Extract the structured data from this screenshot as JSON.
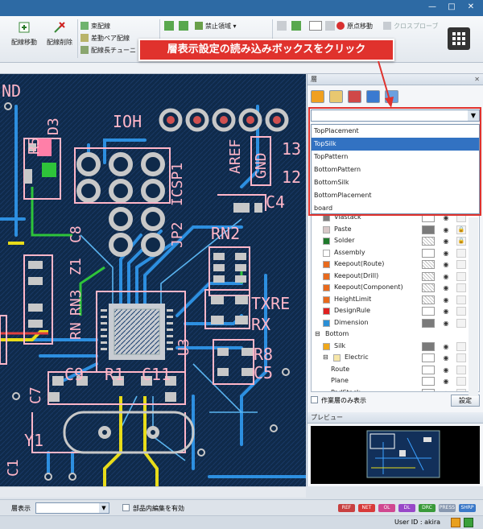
{
  "callout": "層表示設定の読み込みボックスをクリック",
  "ribbon": {
    "route_move": "配線移動",
    "route_delete": "配線削除",
    "bundle_route": "束配線",
    "diff_pair": "差動ペア配線",
    "length_tune": "配線長チューニ",
    "keepout": "禁止領域",
    "origin_move": "原点移動",
    "cross_probe": "クロスプローブ"
  },
  "panel": {
    "title": "層",
    "close": "✕",
    "layer_select_value": "",
    "dropdown_options": [
      "TopPlacement",
      "TopSilk",
      "TopPattern",
      "BottomPattern",
      "BottomSilk",
      "BottomPlacement",
      "board"
    ],
    "selected_option": "TopSilk",
    "layers": [
      {
        "name": "Viastack",
        "color": "#7d7d7d",
        "indent": 1,
        "eye": true
      },
      {
        "name": "Paste",
        "color": "#d8c8c8",
        "indent": 1,
        "eye": true,
        "lock": true,
        "swatch": "#7a7a7a"
      },
      {
        "name": "Solder",
        "color": "#1f7a2b",
        "indent": 1,
        "eye": true,
        "lock": true,
        "hatch": true
      },
      {
        "name": "Assembly",
        "color": "#ffffff",
        "indent": 1,
        "eye": true,
        "swatch": "#ffffff"
      },
      {
        "name": "Keepout(Route)",
        "color": "#e86a1d",
        "indent": 1,
        "eye": true,
        "hatch": true
      },
      {
        "name": "Keepout(Drill)",
        "color": "#e86a1d",
        "indent": 1,
        "eye": true,
        "hatch": true
      },
      {
        "name": "Keepout(Component)",
        "color": "#e86a1d",
        "indent": 1,
        "eye": true,
        "hatch": true
      },
      {
        "name": "HeightLimit",
        "color": "#e86a1d",
        "indent": 1,
        "eye": true,
        "hatch": true
      },
      {
        "name": "DesignRule",
        "color": "#e02020",
        "indent": 1,
        "eye": true,
        "swatch": "#ffffff"
      },
      {
        "name": "Dimension",
        "color": "#2b8fd6",
        "indent": 1,
        "eye": true,
        "swatch": "#7a7a7a"
      },
      {
        "name": "Bottom",
        "color": "",
        "indent": 0,
        "expander": "⊟"
      },
      {
        "name": "Silk",
        "color": "#f0a81a",
        "indent": 1,
        "eye": true,
        "swatch": "#7a7a7a"
      },
      {
        "name": "Electric",
        "color": "#f6e6a8",
        "indent": 1,
        "expander": "⊟",
        "eye": true
      },
      {
        "name": "Route",
        "color": "",
        "indent": 2,
        "eye": true
      },
      {
        "name": "Plane",
        "color": "",
        "indent": 2,
        "eye": true
      },
      {
        "name": "PadStack",
        "color": "",
        "indent": 2,
        "eye": true
      }
    ],
    "only_working_layer": "作業層のみ表示",
    "settings_button": "設定"
  },
  "preview": {
    "title": "プレビュー"
  },
  "statusbar": {
    "layer_display_label": "層表示",
    "layer_display_value": "",
    "edit_in_component": "部品内編集を有効",
    "badges": [
      "REF",
      "NET",
      "OL",
      "DL",
      "DRC",
      "PRESS",
      "SHRP"
    ],
    "user_id": "User ID : akira"
  },
  "pcb_labels": {
    "nd": "ND",
    "ioh": "IOH",
    "d3": "D3",
    "r5": "R5",
    "jp2": "JP2",
    "icsp1": "ICSP1",
    "aref": "AREF",
    "gnd": "GND",
    "num13": "13",
    "num12": "12",
    "c4": "C4",
    "rn2": "RN2",
    "c8": "C8",
    "z1": "Z1",
    "rn3": "RN3",
    "u3": "U3",
    "txre": "TXRE",
    "rx": "RX",
    "r8": "R8",
    "c5": "C5",
    "c9": "C9",
    "r1": "R1",
    "c11": "C11",
    "c7": "C7",
    "y1": "Y1",
    "c1": "C1",
    "rn": "RN"
  },
  "colors": {
    "accent_red": "#e0322d",
    "board_bg": "#0f2a4a",
    "trace_blue": "#2d8fe0",
    "silk": "#ffb6c8",
    "pad": "#c8c8c8",
    "selection": "#3272c2"
  }
}
